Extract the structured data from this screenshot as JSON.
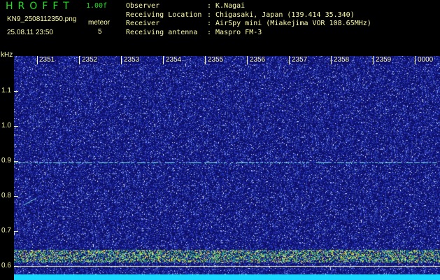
{
  "header": {
    "title": "HROFFT",
    "version": "1.00f",
    "filename": "KN9_2508112350.png",
    "datetime": "25.08.11 23:50",
    "meteor_label": "meteor",
    "meteor_count": "5",
    "info_keys": [
      "Observer",
      "Receiving Location",
      "Receiver",
      "Receiving antenna"
    ],
    "info_values": [
      ": K.Nagai",
      ": Chigasaki, Japan (139.414 35.340)",
      ": AirSpy mini (Miakejima VOR 108.65MHz)",
      ": Maspro FM-3"
    ]
  },
  "axis": {
    "unit": "kHz",
    "time_labels": [
      "2351",
      "2352",
      "2353",
      "2354",
      "2355",
      "2356",
      "2357",
      "2358",
      "2359",
      "0000"
    ],
    "freq_labels": [
      "1.1",
      "1.0",
      "0.9",
      "0.8",
      "0.7",
      "0.6"
    ]
  },
  "colors": {
    "background": "#000000",
    "plot_bg": "#0d0f68",
    "label": "#ffffaa",
    "title": "#1fe01f",
    "carrier_line": "#6fd8e8",
    "noise_band": "#f0e040",
    "bottom_band": "#19d8ff"
  }
}
